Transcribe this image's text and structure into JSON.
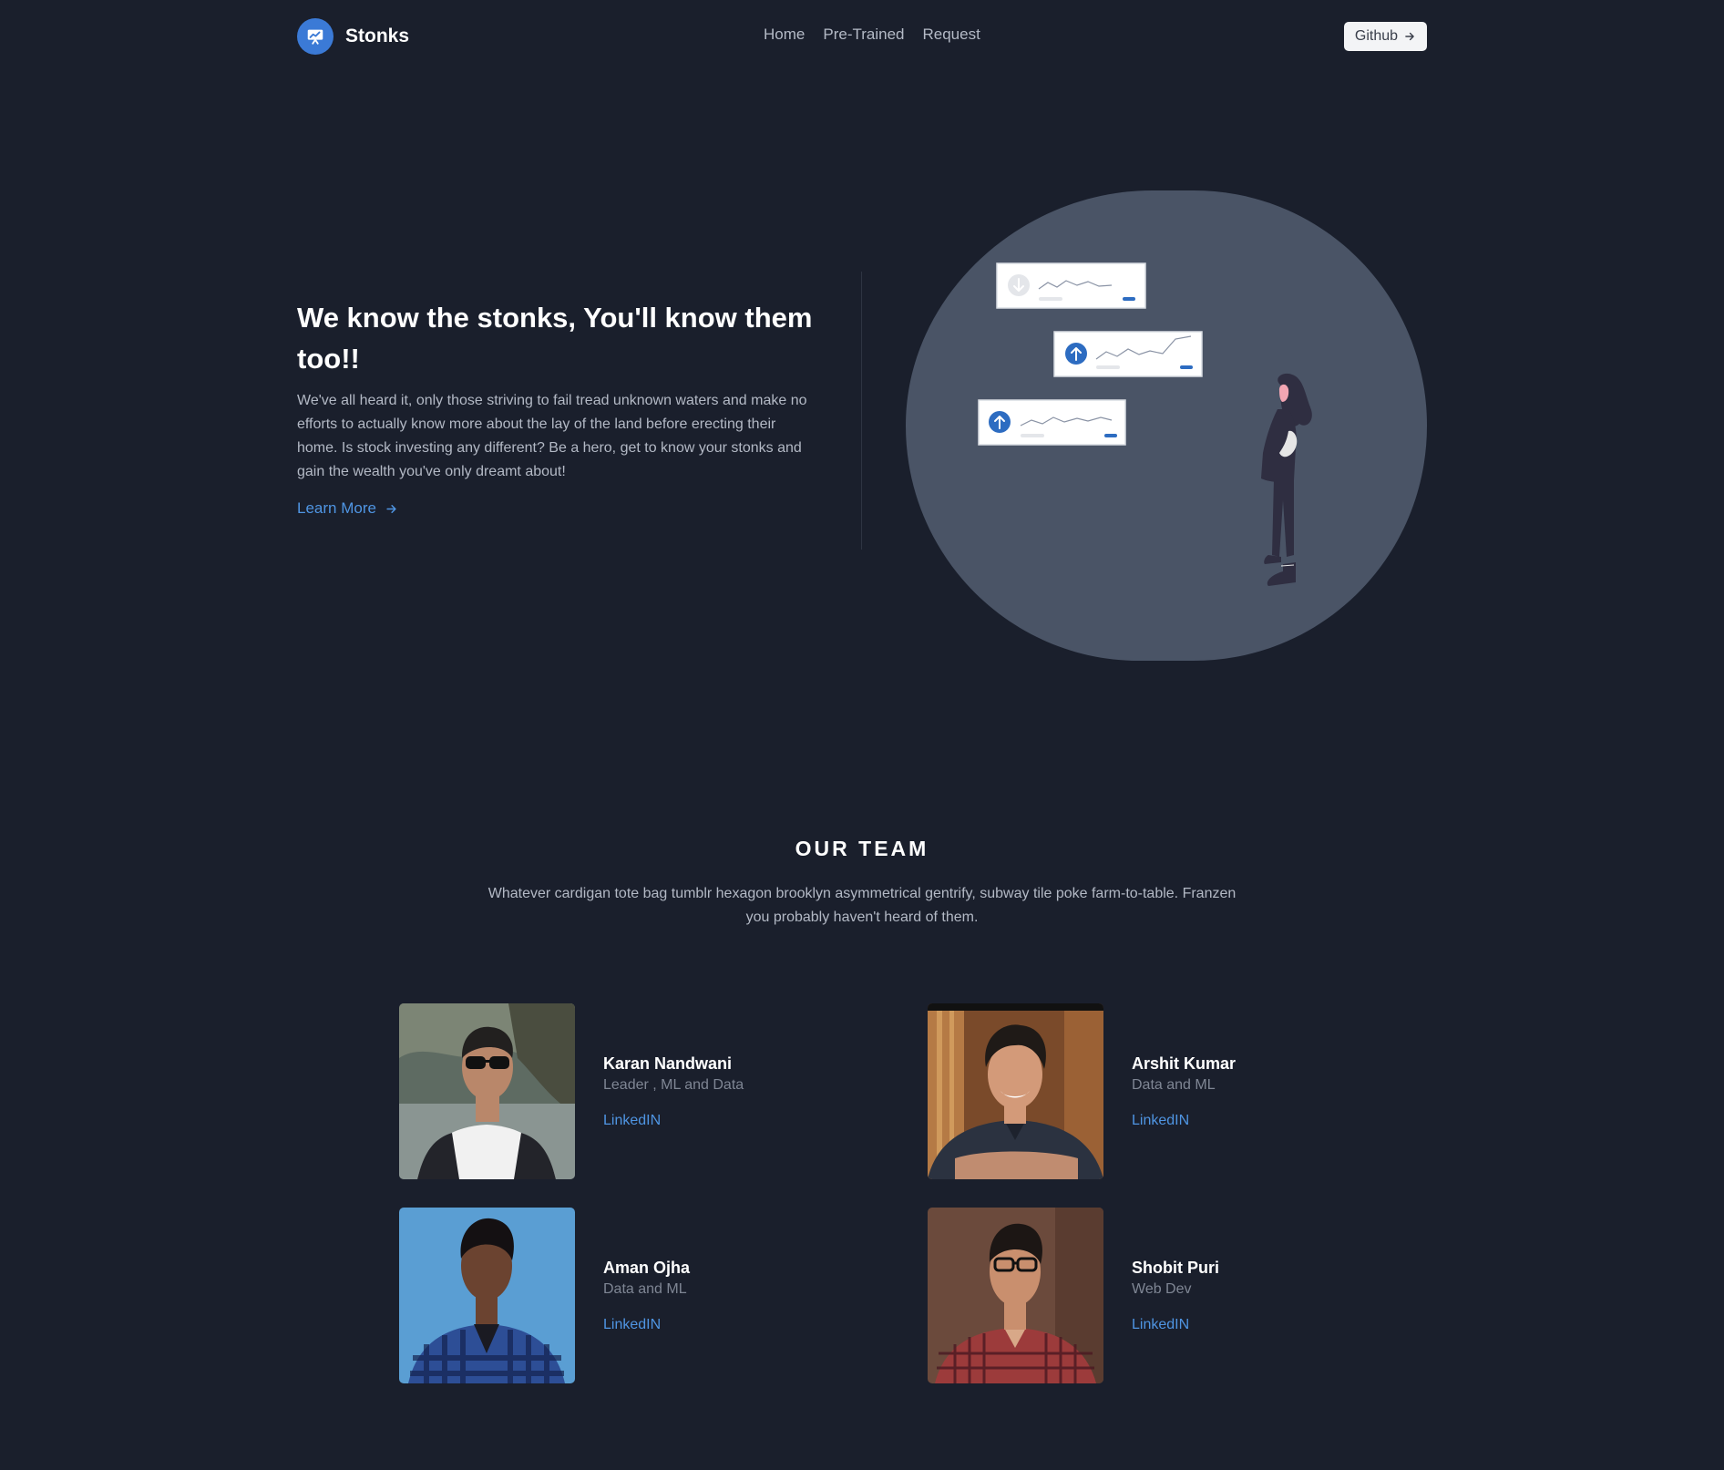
{
  "header": {
    "brand": "Stonks",
    "nav": [
      "Home",
      "Pre-Trained",
      "Request"
    ],
    "github_label": "Github"
  },
  "hero": {
    "title": "We know the stonks, You'll know them too!!",
    "description": "We've all heard it, only those striving to fail tread unknown waters and make no efforts to actually know more about the lay of the land before erecting their home. Is stock investing any different? Be a hero, get to know your stonks and gain the wealth you've only dreamt about!",
    "learn_more": "Learn More"
  },
  "team": {
    "heading": "OUR TEAM",
    "description": "Whatever cardigan tote bag tumblr hexagon brooklyn asymmetrical gentrify, subway tile poke farm-to-table. Franzen you probably haven't heard of them.",
    "members": [
      {
        "name": "Karan Nandwani",
        "role": "Leader , ML and Data",
        "link": "LinkedIN"
      },
      {
        "name": "Arshit Kumar",
        "role": "Data and ML",
        "link": "LinkedIN"
      },
      {
        "name": "Aman Ojha",
        "role": "Data and ML",
        "link": "LinkedIN"
      },
      {
        "name": "Shobit Puri",
        "role": "Web Dev",
        "link": "LinkedIN"
      }
    ]
  },
  "colors": {
    "background": "#1a1f2c",
    "accent": "#3b7ad6",
    "link": "#4f95e3",
    "illustration_blob": "#4a5466"
  },
  "icons": {
    "brand": "chart-presentation-icon",
    "github_arrow": "arrow-right-icon",
    "learn_more_arrow": "arrow-right-icon",
    "card_down": "arrow-down-circle-icon",
    "card_up": "arrow-up-circle-icon"
  }
}
